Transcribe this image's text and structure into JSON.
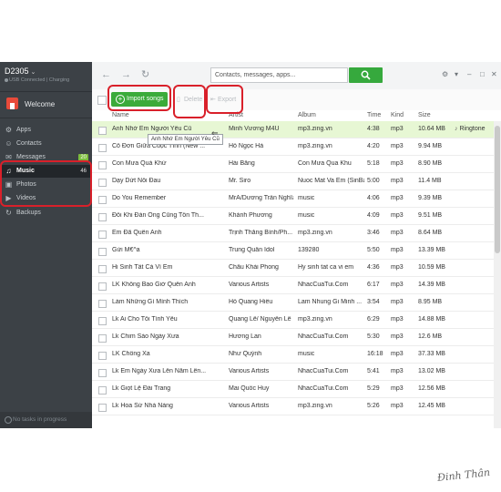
{
  "device": {
    "name": "D2305",
    "status": "USB Connected | Charging"
  },
  "sidebar": {
    "welcome": "Welcome",
    "items": [
      {
        "label": "Apps",
        "icon": "apps-icon",
        "badge": ""
      },
      {
        "label": "Contacts",
        "icon": "contacts-icon",
        "badge": ""
      },
      {
        "label": "Messages",
        "icon": "messages-icon",
        "badge": "20"
      },
      {
        "label": "Music",
        "icon": "music-icon",
        "badge": "46"
      },
      {
        "label": "Photos",
        "icon": "photos-icon",
        "badge": ""
      },
      {
        "label": "Videos",
        "icon": "videos-icon",
        "badge": ""
      },
      {
        "label": "Backups",
        "icon": "backups-icon",
        "badge": ""
      }
    ],
    "tasks": "No tasks in progress"
  },
  "search": {
    "placeholder": "Contacts, messages, apps..."
  },
  "toolbar": {
    "import_label": "Import songs",
    "delete_label": "Delete",
    "export_label": "Export"
  },
  "columns": {
    "name": "Name",
    "artist": "Artist",
    "album": "Album",
    "time": "Time",
    "kind": "Kind",
    "size": "Size"
  },
  "tooltip": "Anh Nhớ Em Người Yêu Cũ",
  "ringtone_label": "Ringtone",
  "songs": [
    {
      "name": "Anh Nhớ Em Người Yêu Cũ",
      "artist": "Minh Vương M4U",
      "album": "mp3.zing.vn",
      "time": "4:38",
      "kind": "mp3",
      "size": "10.64 MB"
    },
    {
      "name": "Cô Đơn Giữa Cuộc Tình (New ...",
      "artist": "Hồ Ngọc Hà",
      "album": "mp3.zing.vn",
      "time": "4:20",
      "kind": "mp3",
      "size": "9.94 MB"
    },
    {
      "name": "Con Mưa Quá Khứ",
      "artist": "Hải Băng",
      "album": "Con Mưa Qua Khu",
      "time": "5:18",
      "kind": "mp3",
      "size": "8.90 MB"
    },
    {
      "name": "Dạy Dứt Nỗi Đau",
      "artist": "Mr. Siro",
      "album": "Nuoc Mat Va Em (SinBa...",
      "time": "5:00",
      "kind": "mp3",
      "size": "11.4 MB"
    },
    {
      "name": "Do You Remember",
      "artist": "MrA/Dương Trần Nghĩa",
      "album": "music",
      "time": "4:06",
      "kind": "mp3",
      "size": "9.39 MB"
    },
    {
      "name": "Đôi Khi Đàn Ông Cũng Tổn Th...",
      "artist": "Khánh Phương",
      "album": "music",
      "time": "4:09",
      "kind": "mp3",
      "size": "9.51 MB"
    },
    {
      "name": "Em Đã Quên Anh",
      "artist": "Trịnh Thăng Bình/Ph...",
      "album": "mp3.zing.vn",
      "time": "3:46",
      "kind": "mp3",
      "size": "8.64 MB"
    },
    {
      "name": "Gửi M€^a",
      "artist": "Trung Quân Idol",
      "album": "139280",
      "time": "5:50",
      "kind": "mp3",
      "size": "13.39 MB"
    },
    {
      "name": "Hi Sinh Tất Cả Vì Em",
      "artist": "Châu Khải Phong",
      "album": "Hy sinh tat ca vi em",
      "time": "4:36",
      "kind": "mp3",
      "size": "10.59 MB"
    },
    {
      "name": "LK Không Bao Giờ Quên Anh",
      "artist": "Various Artists",
      "album": "NhacCuaTui.Com",
      "time": "6:17",
      "kind": "mp3",
      "size": "14.39 MB"
    },
    {
      "name": "Làm Những Gì Mình Thích",
      "artist": "Hồ Quang Hiếu",
      "album": "Lam Nhung Gi Minh ...",
      "time": "3:54",
      "kind": "mp3",
      "size": "8.95 MB"
    },
    {
      "name": "Lk Ai Cho Tôi Tình Yêu",
      "artist": "Quang Lê/ Nguyễn Lê",
      "album": "mp3.zing.vn",
      "time": "6:29",
      "kind": "mp3",
      "size": "14.88 MB"
    },
    {
      "name": "Lk Chim Sáo Ngày Xưa",
      "artist": "Hương Lan",
      "album": "NhacCuaTui.Com",
      "time": "5:30",
      "kind": "mp3",
      "size": "12.6 MB"
    },
    {
      "name": "LK Chồng Xa",
      "artist": "Như Quỳnh",
      "album": "music",
      "time": "16:18",
      "kind": "mp3",
      "size": "37.33 MB"
    },
    {
      "name": "Lk Em Ngày Xưa Lên Năm Lên...",
      "artist": "Various Artists",
      "album": "NhacCuaTui.Com",
      "time": "5:41",
      "kind": "mp3",
      "size": "13.02 MB"
    },
    {
      "name": "Lk Giọt Lệ Đài Trang",
      "artist": "Mai Quốc Huy",
      "album": "NhacCuaTui.Com",
      "time": "5:29",
      "kind": "mp3",
      "size": "12.56 MB"
    },
    {
      "name": "Lk Hoa Sứ Nhà Nàng",
      "artist": "Various Artists",
      "album": "mp3.zing.vn",
      "time": "5:26",
      "kind": "mp3",
      "size": "12.45 MB"
    }
  ],
  "signature": "Đinh Thân"
}
